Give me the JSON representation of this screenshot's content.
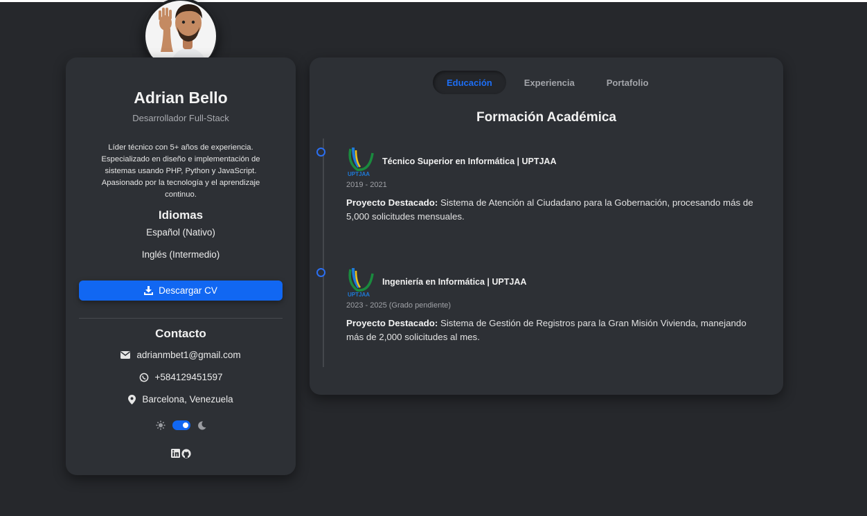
{
  "profile": {
    "name": "Adrian Bello",
    "role": "Desarrollador Full-Stack",
    "bio": "Líder técnico con 5+ años de experiencia. Especializado en diseño e implementación de sistemas usando PHP, Python y JavaScript. Apasionado por la tecnología y el aprendizaje continuo.",
    "languages_title": "Idiomas",
    "languages": [
      "Español (Nativo)",
      "Inglés (Intermedio)"
    ],
    "cv_button": "Descargar CV",
    "contact_title": "Contacto",
    "email": "adrianmbet1@gmail.com",
    "phone": "+584129451597",
    "location": "Barcelona, Venezuela",
    "theme_toggle_on": true
  },
  "tabs": [
    {
      "label": "Educación",
      "active": true
    },
    {
      "label": "Experiencia",
      "active": false
    },
    {
      "label": "Portafolio",
      "active": false
    }
  ],
  "main_title": "Formación Académica",
  "education": [
    {
      "title": "Técnico Superior en Informática | UPTJAA",
      "dates": "2019 - 2021",
      "highlight_label": "Proyecto Destacado:",
      "highlight_text": " Sistema de Atención al Ciudadano para la Gobernación, procesando más de 5,000 solicitudes mensuales.",
      "logo_text": "UPTJAA"
    },
    {
      "title": "Ingeniería en Informática | UPTJAA",
      "dates": "2023 - 2025 (Grado pendiente)",
      "highlight_label": "Proyecto Destacado:",
      "highlight_text": " Sistema de Gestión de Registros para la Gran Misión Vivienda, manejando más de 2,000 solicitudes al mes.",
      "logo_text": "UPTJAA"
    }
  ],
  "colors": {
    "accent": "#1167f2",
    "background": "#26282c",
    "card": "#2d3035"
  }
}
